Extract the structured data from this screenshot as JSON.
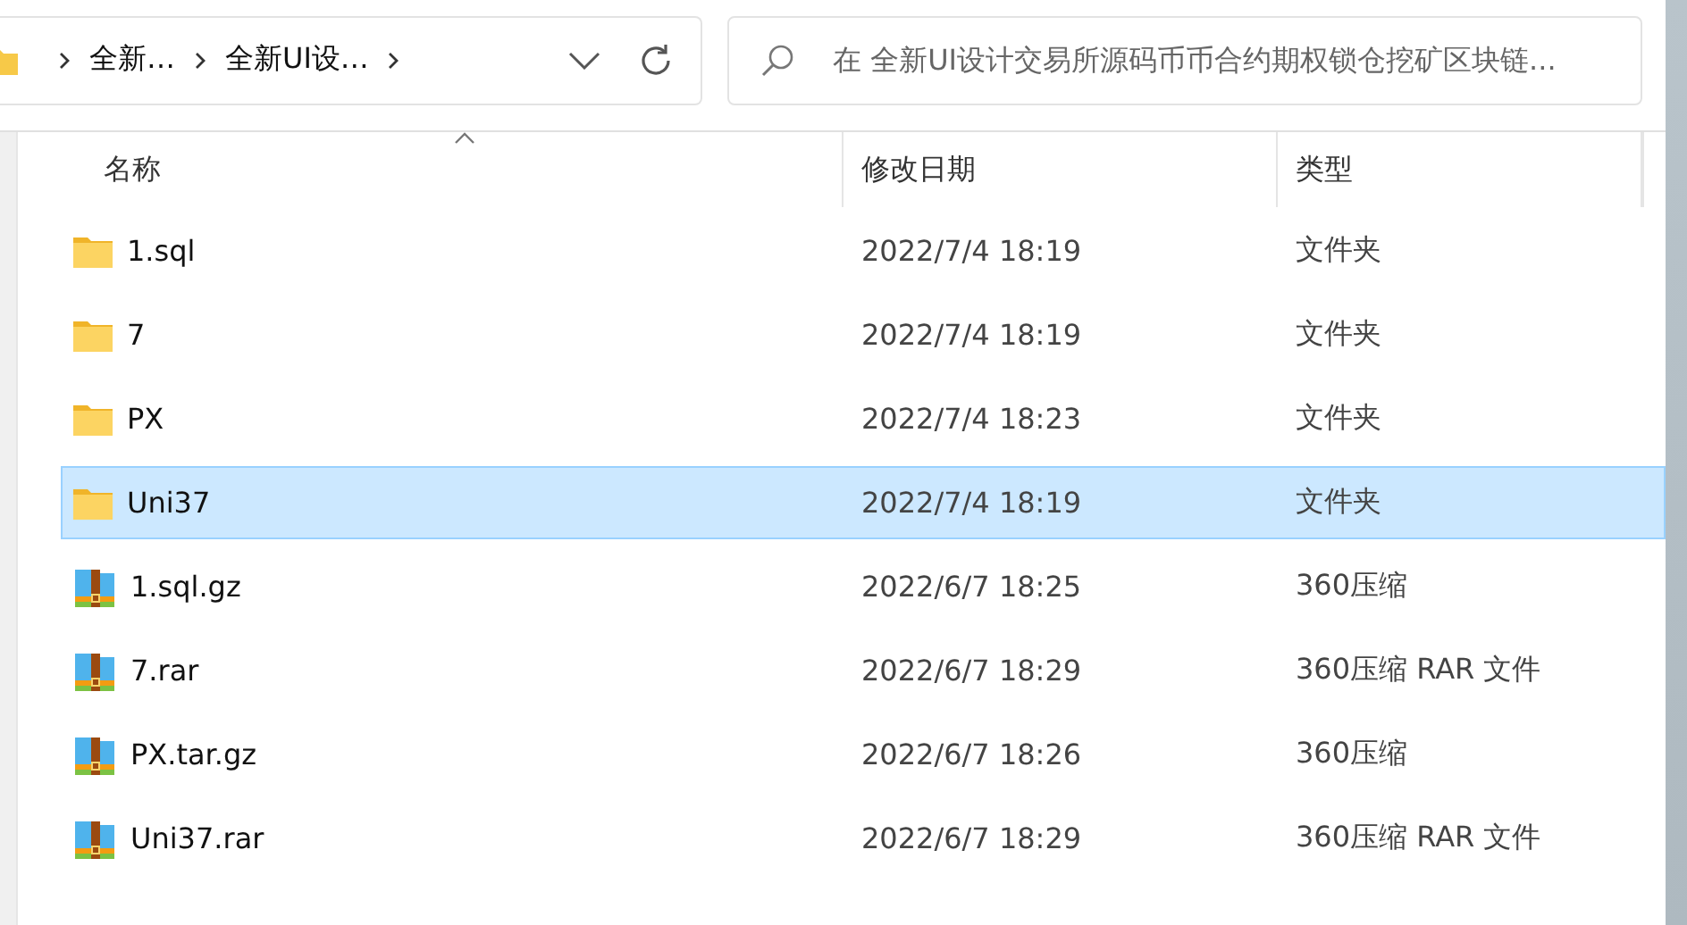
{
  "address_bar": {
    "crumbs": [
      "全新…",
      "全新UI设…"
    ]
  },
  "search": {
    "placeholder": "在 全新UI设计交易所源码币币合约期权锁仓挖矿区块链..."
  },
  "table": {
    "columns": [
      "名称",
      "修改日期",
      "类型"
    ],
    "rows": [
      {
        "kind": "folder",
        "name": "1.sql",
        "date": "2022/7/4 18:19",
        "type": "文件夹",
        "selected": false
      },
      {
        "kind": "folder",
        "name": "7",
        "date": "2022/7/4 18:19",
        "type": "文件夹",
        "selected": false
      },
      {
        "kind": "folder",
        "name": "PX",
        "date": "2022/7/4 18:23",
        "type": "文件夹",
        "selected": false
      },
      {
        "kind": "folder",
        "name": "Uni37",
        "date": "2022/7/4 18:19",
        "type": "文件夹",
        "selected": true
      },
      {
        "kind": "archive",
        "name": "1.sql.gz",
        "date": "2022/6/7 18:25",
        "type": "360压缩",
        "selected": false
      },
      {
        "kind": "archive",
        "name": "7.rar",
        "date": "2022/6/7 18:29",
        "type": "360压缩 RAR 文件",
        "selected": false
      },
      {
        "kind": "archive",
        "name": "PX.tar.gz",
        "date": "2022/6/7 18:26",
        "type": "360压缩",
        "selected": false
      },
      {
        "kind": "archive",
        "name": "Uni37.rar",
        "date": "2022/6/7 18:29",
        "type": "360压缩 RAR 文件",
        "selected": false
      }
    ]
  }
}
